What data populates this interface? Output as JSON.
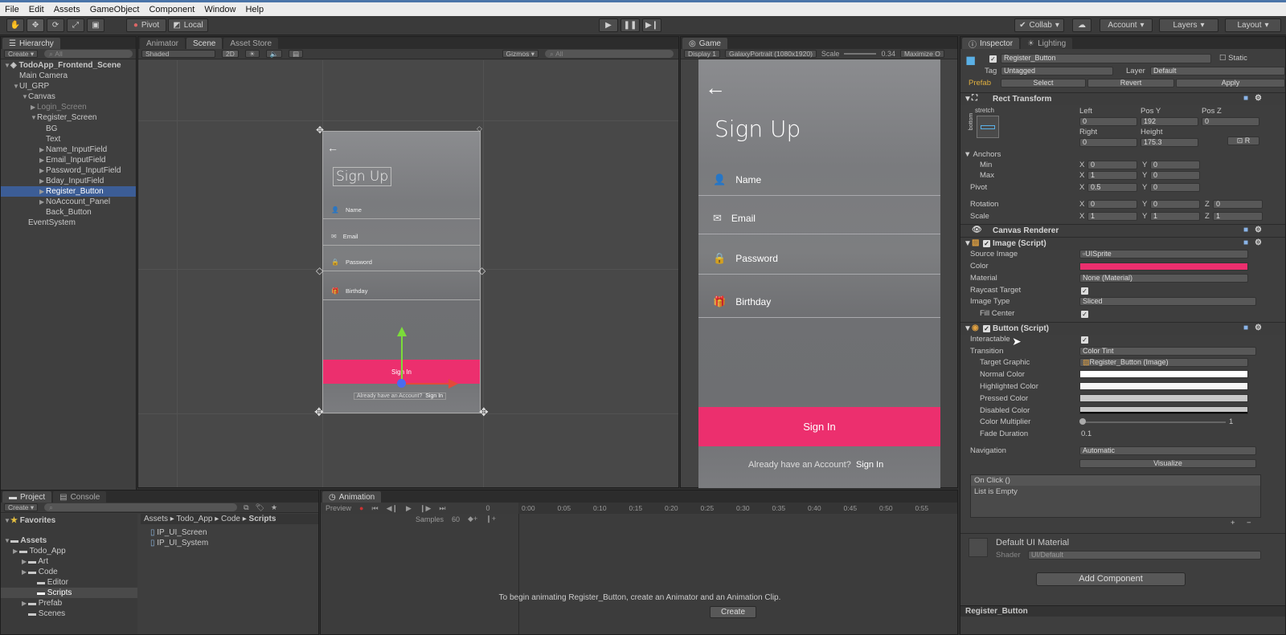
{
  "menu": [
    "File",
    "Edit",
    "Assets",
    "GameObject",
    "Component",
    "Window",
    "Help"
  ],
  "toolbar": {
    "pivot": "Pivot",
    "local": "Local",
    "collab": "Collab",
    "account": "Account",
    "layers": "Layers",
    "layout": "Layout"
  },
  "hierarchy": {
    "tab": "Hierarchy",
    "create": "Create",
    "search": "All",
    "scene": "TodoApp_Frontend_Scene",
    "items": [
      {
        "label": "Main Camera",
        "indent": 1,
        "arrow": false,
        "state": ""
      },
      {
        "label": "UI_GRP",
        "indent": 1,
        "arrow": "open",
        "state": ""
      },
      {
        "label": "Canvas",
        "indent": 2,
        "arrow": "open",
        "state": ""
      },
      {
        "label": "Login_Screen",
        "indent": 3,
        "arrow": "closed",
        "state": "dim"
      },
      {
        "label": "Register_Screen",
        "indent": 3,
        "arrow": "open",
        "state": ""
      },
      {
        "label": "BG",
        "indent": 4,
        "arrow": false,
        "state": ""
      },
      {
        "label": "Text",
        "indent": 4,
        "arrow": false,
        "state": ""
      },
      {
        "label": "Name_InputField",
        "indent": 4,
        "arrow": "closed",
        "state": ""
      },
      {
        "label": "Email_InputField",
        "indent": 4,
        "arrow": "closed",
        "state": ""
      },
      {
        "label": "Password_InputField",
        "indent": 4,
        "arrow": "closed",
        "state": ""
      },
      {
        "label": "Bday_InputField",
        "indent": 4,
        "arrow": "closed",
        "state": ""
      },
      {
        "label": "Register_Button",
        "indent": 4,
        "arrow": "closed",
        "state": "sel"
      },
      {
        "label": "NoAccount_Panel",
        "indent": 4,
        "arrow": "closed",
        "state": ""
      },
      {
        "label": "Back_Button",
        "indent": 4,
        "arrow": false,
        "state": ""
      },
      {
        "label": "EventSystem",
        "indent": 2,
        "arrow": false,
        "state": ""
      }
    ]
  },
  "scene": {
    "tabs": [
      "Animator",
      "Scene",
      "Asset Store"
    ],
    "shaded": "Shaded",
    "mode2d": "2D",
    "gizmos": "Gizmos",
    "search": "All",
    "signup": "Sign Up",
    "fields": [
      "Name",
      "Email",
      "Password",
      "Birthday"
    ],
    "signin": "Sign In",
    "noaccount": "Already have an Account?",
    "noaccount_link": "Sign In"
  },
  "game": {
    "tab": "Game",
    "display": "Display 1",
    "res": "GalaxyPortrait (1080x1920)",
    "scale_label": "Scale",
    "scale": "0.34",
    "maximize": "Maximize O",
    "signup": "Sign Up",
    "fields": [
      "Name",
      "Email",
      "Password",
      "Birthday"
    ],
    "signin": "Sign In",
    "noaccount": "Already have an Account?",
    "noaccount_link": "Sign In"
  },
  "inspector": {
    "tabs": [
      "Inspector",
      "Lighting"
    ],
    "name": "Register_Button",
    "static": "Static",
    "tag_label": "Tag",
    "tag": "Untagged",
    "layer_label": "Layer",
    "layer": "Default",
    "prefab": "Prefab",
    "select": "Select",
    "revert": "Revert",
    "apply": "Apply",
    "rect_title": "Rect Transform",
    "stretch": "stretch",
    "bottom": "bottom",
    "left_lbl": "Left",
    "posy_lbl": "Pos Y",
    "posz_lbl": "Pos Z",
    "left": "0",
    "posy": "192",
    "posz": "0",
    "right_lbl": "Right",
    "height_lbl": "Height",
    "right": "0",
    "height": "175.3",
    "anchors": "Anchors",
    "min": "Min",
    "max": "Max",
    "pivot": "Pivot",
    "min_x": "0",
    "min_y": "0",
    "max_x": "1",
    "max_y": "0",
    "pivot_x": "0.5",
    "pivot_y": "0",
    "rotation": "Rotation",
    "rot_x": "0",
    "rot_y": "0",
    "rot_z": "0",
    "scale": "Scale",
    "sc_x": "1",
    "sc_y": "1",
    "sc_z": "1",
    "canvas_renderer": "Canvas Renderer",
    "image_title": "Image (Script)",
    "source_image": "Source Image",
    "source_val": "UISprite",
    "color": "Color",
    "color_val": "#ec2f6e",
    "material": "Material",
    "material_val": "None (Material)",
    "raycast": "Raycast Target",
    "image_type": "Image Type",
    "image_type_val": "Sliced",
    "fill_center": "Fill Center",
    "button_title": "Button (Script)",
    "interactable": "Interactable",
    "transition": "Transition",
    "transition_val": "Color Tint",
    "target_graphic": "Target Graphic",
    "target_val": "Register_Button (Image)",
    "normal": "Normal Color",
    "highlighted": "Highlighted Color",
    "pressed": "Pressed Color",
    "disabled": "Disabled Color",
    "multiplier": "Color Multiplier",
    "multiplier_val": "1",
    "fade": "Fade Duration",
    "fade_val": "0.1",
    "navigation": "Navigation",
    "navigation_val": "Automatic",
    "visualize": "Visualize",
    "onclick": "On Click ()",
    "list_empty": "List is Empty",
    "material_name": "Default UI Material",
    "shader_lbl": "Shader",
    "shader_val": "UI/Default",
    "add_component": "Add Component",
    "footer": "Register_Button"
  },
  "project": {
    "tabs": [
      "Project",
      "Console"
    ],
    "create": "Create",
    "favorites": "Favorites",
    "assets": "Assets",
    "tree": [
      {
        "label": "Todo_App",
        "indent": 1
      },
      {
        "label": "Art",
        "indent": 2
      },
      {
        "label": "Code",
        "indent": 2
      },
      {
        "label": "Editor",
        "indent": 3
      },
      {
        "label": "Scripts",
        "indent": 3
      },
      {
        "label": "Prefab",
        "indent": 2
      },
      {
        "label": "Scenes",
        "indent": 2
      }
    ],
    "breadcrumb": [
      "Assets",
      "Todo_App",
      "Code",
      "Scripts"
    ],
    "files": [
      "IP_UI_Screen",
      "IP_UI_System"
    ]
  },
  "animation": {
    "tab": "Animation",
    "preview": "Preview",
    "samples_lbl": "Samples",
    "samples": "60",
    "frame": "0",
    "ticks": [
      "0:00",
      "0:05",
      "0:10",
      "0:15",
      "0:20",
      "0:25",
      "0:30",
      "0:35",
      "0:40",
      "0:45",
      "0:50",
      "0:55"
    ],
    "message": "To begin animating Register_Button, create an Animator and an Animation Clip.",
    "create": "Create"
  }
}
